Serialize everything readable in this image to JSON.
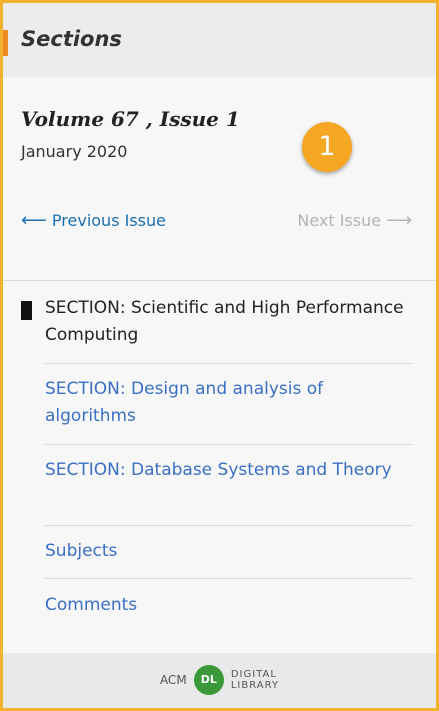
{
  "header": {
    "title": "Sections"
  },
  "issue": {
    "volume_label": "Volume 67 , Issue 1",
    "date": "January 2020",
    "badge": "1"
  },
  "nav": {
    "previous_label": "Previous Issue",
    "previous_arrow": "⟵",
    "next_label": "Next Issue",
    "next_arrow": "⟶"
  },
  "sections": [
    {
      "label": "SECTION: Scientific and High Performance Computing",
      "current": true
    },
    {
      "label": "SECTION: Design and analysis of algorithms",
      "current": false
    },
    {
      "label": "SECTION: Database Systems and Theory",
      "current": false
    },
    {
      "label": "Subjects",
      "current": false
    },
    {
      "label": "Comments",
      "current": false
    }
  ],
  "footer": {
    "acm": "ACM",
    "dl": "DL",
    "digital": "DIGITAL",
    "library": "LIBRARY"
  },
  "colors": {
    "frame": "#f2b12e",
    "accent": "#f08a24",
    "link": "#3a6fc4",
    "badge": "#f5a623"
  }
}
